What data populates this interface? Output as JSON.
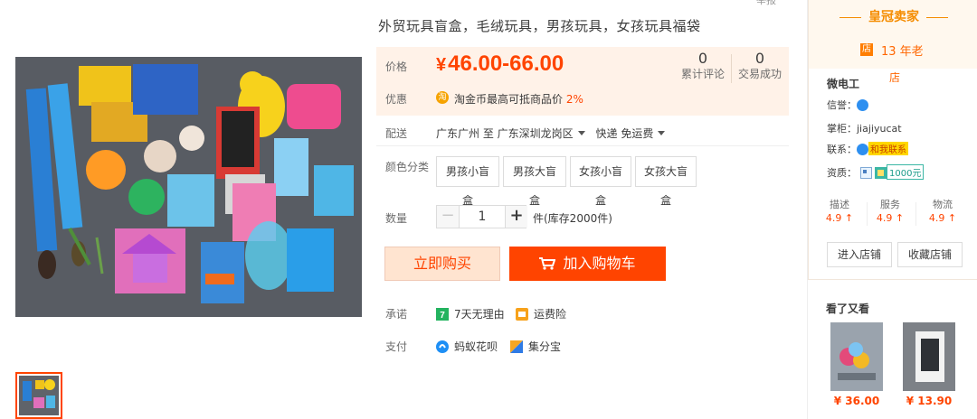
{
  "header": {
    "cut_text": "举报"
  },
  "product": {
    "title": "外贸玩具盲盒，毛绒玩具，男孩玩具，女孩玩具福袋",
    "price_label": "价格",
    "currency": "¥",
    "price": "46.00-66.00",
    "reviews_count": "0",
    "reviews_label": "累计评论",
    "deals_count": "0",
    "deals_label": "交易成功",
    "promo_label": "优惠",
    "promo_text": "淘金币最高可抵商品价",
    "promo_pct": "2%",
    "ship_label": "配送",
    "ship_from": "广东广州 至",
    "ship_to": "广东深圳龙岗区",
    "ship_method": "快递 免运费",
    "color_label": "颜色分类",
    "skus": [
      "男孩小盲盒",
      "男孩大盲盒",
      "女孩小盲盒",
      "女孩大盲盒"
    ],
    "qty_label": "数量",
    "qty_value": "1",
    "qty_minus": "−",
    "qty_plus": "+",
    "stock_text": "件(库存2000件)",
    "buy_now": "立即购买",
    "add_cart": "加入购物车",
    "promise_label": "承诺",
    "promise_items": [
      "7天无理由",
      "运费险"
    ],
    "pay_label": "支付",
    "pay_items": [
      "蚂蚁花呗",
      "集分宝"
    ]
  },
  "seller": {
    "crown_title": "皇冠卖家",
    "shop_badge": "店",
    "years_line1": "13 年老",
    "years_line2": "店",
    "shop_name": "微电工",
    "credit_label": "信誉：",
    "keeper_label": "掌柜：",
    "keeper_value": "jiajiyucat",
    "contact_label": "联系：",
    "contact_chip": "和我联系",
    "cert_label": "资质：",
    "cert_chip": "1000元",
    "ratings": [
      {
        "label": "描述",
        "value": "4.9 ↑"
      },
      {
        "label": "服务",
        "value": "4.9 ↑"
      },
      {
        "label": "物流",
        "value": "4.9 ↑"
      }
    ],
    "enter_shop": "进入店铺",
    "fav_shop": "收藏店铺"
  },
  "also_viewed": {
    "title": "看了又看",
    "items": [
      {
        "price": "¥ 36.00"
      },
      {
        "price": "¥ 13.90"
      }
    ]
  },
  "colors": {
    "accent": "#ff4400",
    "price_bg": "#fff2e8",
    "crown": "#f58c00"
  }
}
